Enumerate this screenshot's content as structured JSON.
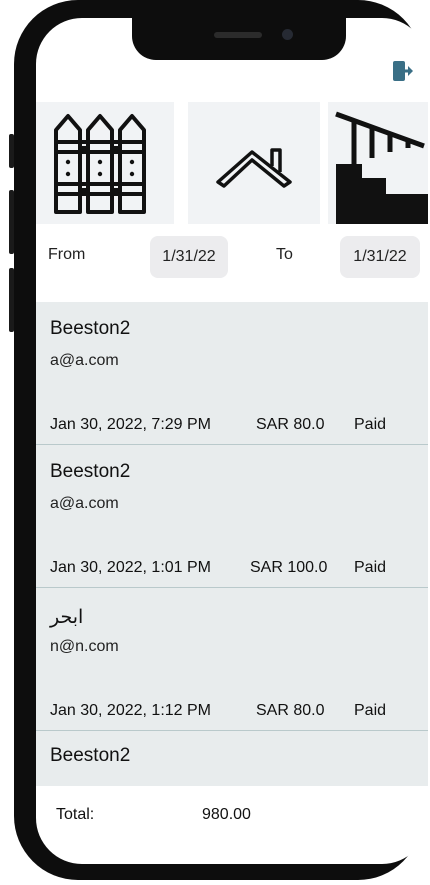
{
  "icons": {
    "logout": "logout-icon",
    "fence": "fence-icon",
    "roof": "roof-icon",
    "stairs": "stairs-icon"
  },
  "colors": {
    "logout_accent": "#3a6f86",
    "list_background": "#e8eced",
    "date_button": "#ececee"
  },
  "filter": {
    "from_label": "From",
    "from_value": "1/31/22",
    "to_label": "To",
    "to_value": "1/31/22"
  },
  "payments": [
    {
      "name": "Beeston2",
      "email": "a@a.com",
      "date": "Jan 30, 2022, 7:29 PM",
      "amount": "SAR 80.0",
      "status": "Paid"
    },
    {
      "name": "Beeston2",
      "email": "a@a.com",
      "date": "Jan 30, 2022, 1:01 PM",
      "amount": "SAR 100.0",
      "status": "Paid"
    },
    {
      "name": "ابحر",
      "email": "n@n.com",
      "date": "Jan 30, 2022, 1:12 PM",
      "amount": "SAR 80.0",
      "status": "Paid"
    },
    {
      "name": "Beeston2"
    }
  ],
  "summary": {
    "total_label": "Total:",
    "total_value": "980.00"
  }
}
